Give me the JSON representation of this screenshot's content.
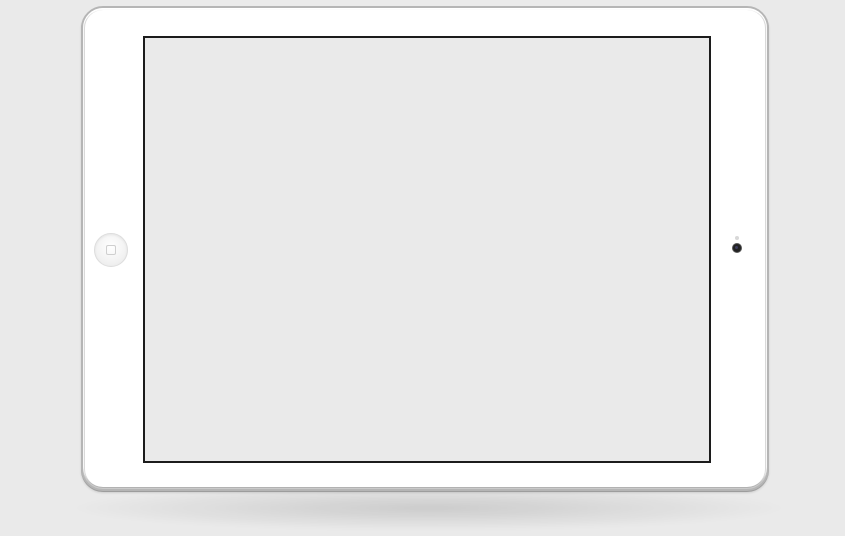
{
  "device": {
    "type": "tablet",
    "orientation": "landscape",
    "frame_color": "#ffffff",
    "screen_color": "#eaeaea",
    "background_color": "#eaeaea"
  },
  "screen": {
    "content": ""
  },
  "icons": {
    "home_button": "home-button-icon",
    "camera": "camera-icon",
    "sensor": "sensor-dot-icon"
  }
}
